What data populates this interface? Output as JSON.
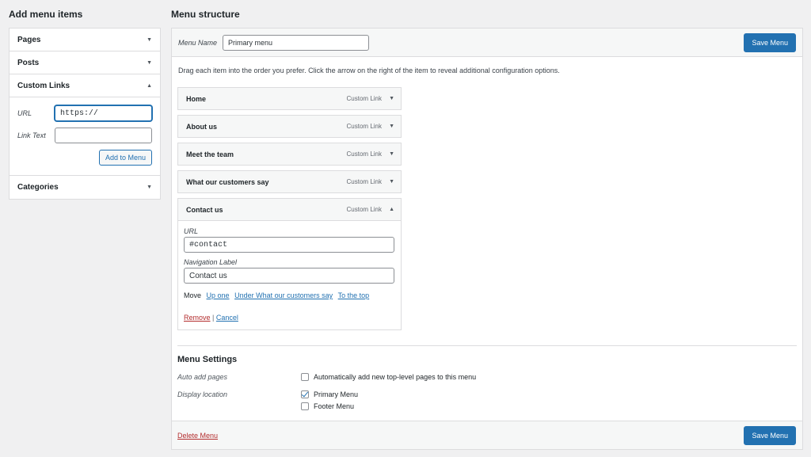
{
  "left": {
    "heading": "Add menu items",
    "sections": {
      "pages": "Pages",
      "posts": "Posts",
      "custom_links": "Custom Links",
      "categories": "Categories"
    },
    "custom_links_form": {
      "url_label": "URL",
      "url_value": "https://",
      "link_text_label": "Link Text",
      "link_text_value": "",
      "add_button": "Add to Menu"
    }
  },
  "right": {
    "heading": "Menu structure",
    "menu_name_label": "Menu Name",
    "menu_name_value": "Primary menu",
    "save_button": "Save Menu",
    "instructions": "Drag each item into the order you prefer. Click the arrow on the right of the item to reveal additional configuration options.",
    "items": [
      {
        "title": "Home",
        "type": "Custom Link"
      },
      {
        "title": "About us",
        "type": "Custom Link"
      },
      {
        "title": "Meet the team",
        "type": "Custom Link"
      },
      {
        "title": "What our customers say",
        "type": "Custom Link"
      },
      {
        "title": "Contact us",
        "type": "Custom Link"
      }
    ],
    "open_item": {
      "url_label": "URL",
      "url_value": "#contact",
      "nav_label": "Navigation Label",
      "nav_value": "Contact us",
      "move_label": "Move",
      "move_up": "Up one",
      "move_under": "Under What our customers say",
      "move_top": "To the top",
      "remove": "Remove",
      "separator": "|",
      "cancel": "Cancel"
    },
    "settings": {
      "heading": "Menu Settings",
      "auto_add_label": "Auto add pages",
      "auto_add_option": "Automatically add new top-level pages to this menu",
      "display_label": "Display location",
      "primary_option": "Primary Menu",
      "footer_option": "Footer Menu"
    },
    "delete_link": "Delete Menu",
    "save_button_bottom": "Save Menu"
  },
  "icons": {
    "collapsed": "caret-down-icon",
    "expanded": "caret-up-icon"
  },
  "colors": {
    "primary": "#2271b1",
    "danger": "#b32d2e",
    "background": "#f0f0f1"
  }
}
